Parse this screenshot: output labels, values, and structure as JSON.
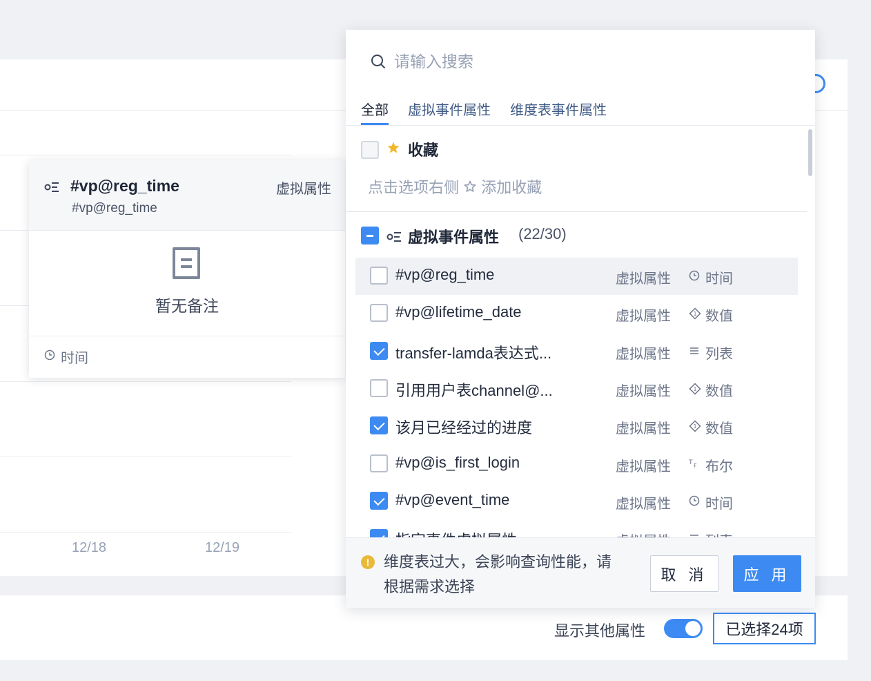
{
  "background": {
    "x_ticks": [
      "12/18",
      "12/19"
    ],
    "show_other_label": "显示其他属性",
    "show_other_on": true,
    "selected_label": "已选择24项"
  },
  "tooltip": {
    "name": "#vp@reg_time",
    "sub": "#vp@reg_time",
    "tag": "虚拟属性",
    "empty": "暂无备注",
    "type": "时间"
  },
  "panel": {
    "search_placeholder": "请输入搜索",
    "tabs": [
      {
        "label": "全部",
        "active": true
      },
      {
        "label": "虚拟事件属性",
        "active": false
      },
      {
        "label": "维度表事件属性",
        "active": false
      }
    ],
    "favorites": {
      "title": "收藏",
      "hint_before": "点击选项右侧",
      "hint_after": "添加收藏"
    },
    "group": {
      "title": "虚拟事件属性",
      "count": "(22/30)"
    },
    "items": [
      {
        "name": "#vp@reg_time",
        "tag": "虚拟属性",
        "type": "时间",
        "type_icon": "clock-icon",
        "checked": false
      },
      {
        "name": "#vp@lifetime_date",
        "tag": "虚拟属性",
        "type": "数值",
        "type_icon": "number-icon",
        "checked": false
      },
      {
        "name": "transfer-lamda表达式...",
        "tag": "虚拟属性",
        "type": "列表",
        "type_icon": "list-icon",
        "checked": true
      },
      {
        "name": "引用用户表channel@...",
        "tag": "虚拟属性",
        "type": "数值",
        "type_icon": "number-icon",
        "checked": false
      },
      {
        "name": "该月已经经过的进度",
        "tag": "虚拟属性",
        "type": "数值",
        "type_icon": "number-icon",
        "checked": true
      },
      {
        "name": "#vp@is_first_login",
        "tag": "虚拟属性",
        "type": "布尔",
        "type_icon": "boolean-icon",
        "checked": false
      },
      {
        "name": "#vp@event_time",
        "tag": "虚拟属性",
        "type": "时间",
        "type_icon": "clock-icon",
        "checked": true
      },
      {
        "name": "指定事件虚拟属性",
        "tag": "虚拟属性",
        "type": "列表",
        "type_icon": "list-icon",
        "checked": true
      }
    ],
    "footer": {
      "warning": "维度表过大，会影响查询性能，请根据需求选择",
      "cancel": "取 消",
      "apply": "应 用"
    },
    "colors": {
      "accent": "#3d8bf2",
      "star": "#f3b72b",
      "warning": "#e9b93a"
    }
  }
}
